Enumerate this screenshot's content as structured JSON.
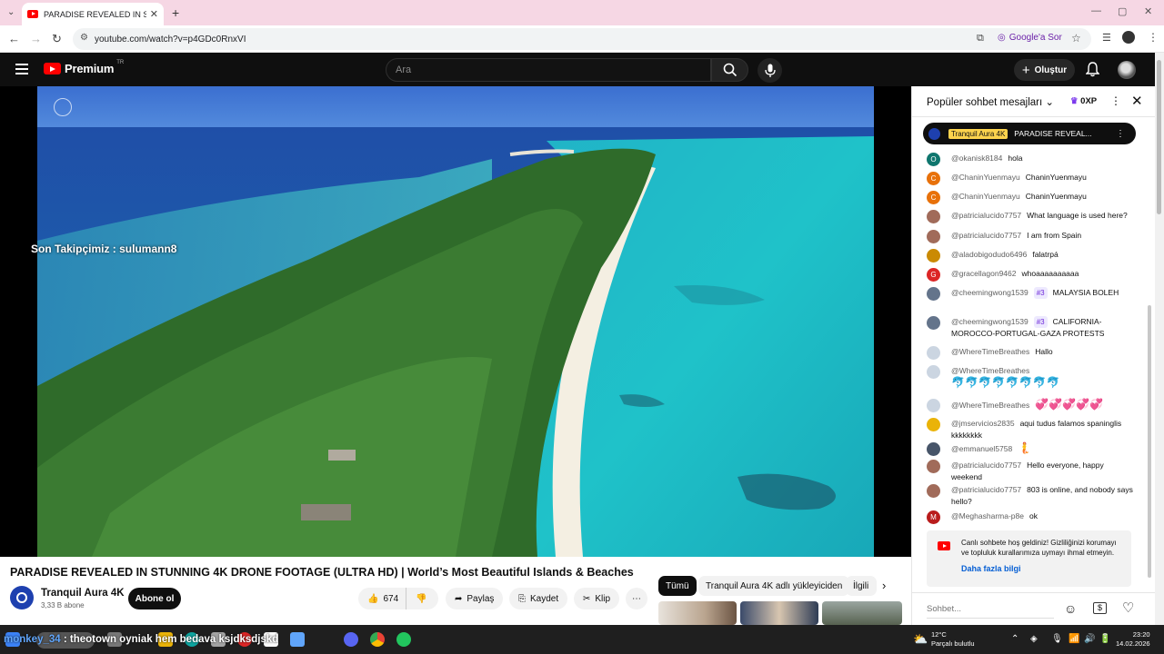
{
  "browser": {
    "tab_title": "PARADISE REVEALED IN STUNN",
    "url": "youtube.com/watch?v=p4GDc0RnxVI",
    "google_search_label": "Google'a Sor"
  },
  "header": {
    "logo_text": "Premium",
    "region": "TR",
    "search_placeholder": "Ara",
    "create_label": "Oluştur"
  },
  "video": {
    "overlay_text": "Son Takipçimiz : sulumann8",
    "title": "PARADISE REVEALED IN STUNNING 4K DRONE FOOTAGE (ULTRA HD) | World’s Most Beautiful Islands & Beaches"
  },
  "channel": {
    "name": "Tranquil Aura 4K",
    "subscribers": "3,33 B abone",
    "subscribe_label": "Abone ol"
  },
  "actions": {
    "like_count": "674",
    "share_label": "Paylaş",
    "save_label": "Kaydet",
    "clip_label": "Klip"
  },
  "chips": [
    {
      "label": "Tümü"
    },
    {
      "label": "Tranquil Aura 4K adlı yükleyiciden"
    },
    {
      "label": "İlgili"
    }
  ],
  "chat": {
    "mode_label": "Popüler sohbet mesajları",
    "xp_label": "0XP",
    "pinned": {
      "author": "Tranquil Aura 4K",
      "text": "PARADISE REVEAL..."
    },
    "messages": [
      {
        "author": "@okanisk8184",
        "text": "hola",
        "initial": "O",
        "color": "#0f766e"
      },
      {
        "author": "@ChaninYuenmayu",
        "text": "ChaninYuenmayu",
        "initial": "C",
        "color": "#e8710a"
      },
      {
        "author": "@ChaninYuenmayu",
        "text": "ChaninYuenmayu",
        "initial": "C",
        "color": "#e8710a"
      },
      {
        "author": "@patricialucido7757",
        "text": "What language is used here?",
        "initial": "",
        "color": "#a16b5a"
      },
      {
        "author": "@patricialucido7757",
        "text": "I am from Spain",
        "initial": "",
        "color": "#a16b5a"
      },
      {
        "author": "@aladobigodudo6496",
        "text": "falatrpá",
        "initial": "",
        "color": "#ca8a04"
      },
      {
        "author": "@gracellagon9462",
        "text": "whoaaaaaaaaaa",
        "initial": "G",
        "color": "#dc2626"
      },
      {
        "author": "@cheemingwong1539",
        "badge": "#3",
        "text": "MALAYSIA BOLEH",
        "initial": "",
        "color": "#64748b"
      },
      {
        "author": "@cheemingwong1539",
        "badge": "#3",
        "text": "CALIFORNIA-MOROCCO-PORTUGAL-GAZA PROTESTS",
        "initial": "",
        "color": "#64748b"
      },
      {
        "author": "@WhereTimeBreathes",
        "text": "Hallo",
        "initial": "",
        "color": "#cbd5e1"
      },
      {
        "author": "@WhereTimeBreathes",
        "text": "",
        "initial": "",
        "color": "#cbd5e1",
        "emoji": "🐬🐬🐬🐬🐬🐬🐬🐬"
      },
      {
        "author": "@WhereTimeBreathes",
        "text": "",
        "initial": "",
        "color": "#cbd5e1",
        "emoji": "💞💞💞💞💞"
      },
      {
        "author": "@jmservicios2835",
        "text": "aqui tudus falamos spaninglis kkkkkkkk",
        "initial": "",
        "color": "#eab308"
      },
      {
        "author": "@emmanuel5758",
        "text": "",
        "initial": "",
        "color": "#475569",
        "emoji": "🧜"
      },
      {
        "author": "@patricialucido7757",
        "text": "Hello everyone, happy weekend",
        "initial": "",
        "color": "#a16b5a"
      },
      {
        "author": "@patricialucido7757",
        "text": "803 is online, and nobody says hello?",
        "initial": "",
        "color": "#a16b5a"
      },
      {
        "author": "@Meghasharma-p8e",
        "text": "ok",
        "initial": "M",
        "color": "#b91c1c"
      }
    ],
    "welcome_text": "Canlı sohbete hoş geldiniz! Gizliliğinizi korumayı ve topluluk kurallarımıza uymayı ihmal etmeyin.",
    "welcome_more": "Daha fazla bilgi",
    "input_placeholder": "Sohbet..."
  },
  "taskbar": {
    "ticker_user": "monkey_34",
    "ticker_text": ": theotown oyniak hem bedava ksjdksdjskd",
    "weather_temp": "12°C",
    "weather_desc": "Parçalı bulutlu",
    "time": "23:20",
    "date": "14.02.2026"
  }
}
